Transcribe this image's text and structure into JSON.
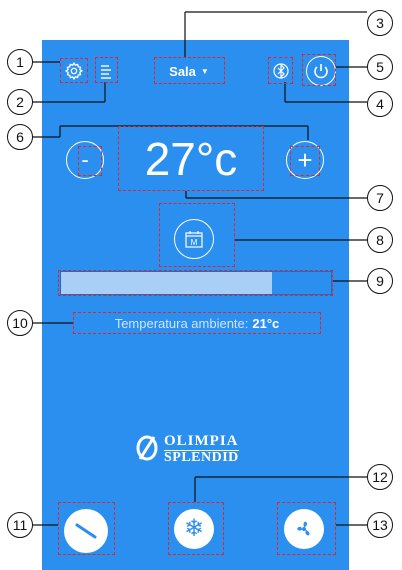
{
  "header": {
    "room_selector": "Sala",
    "settings_icon": "gear-icon",
    "menu_icon": "menu-icon",
    "bluetooth_icon": "bluetooth-icon",
    "power_icon": "power-icon"
  },
  "temperature": {
    "setpoint": "27°c",
    "minus_label": "-",
    "plus_label": "+"
  },
  "schedule": {
    "mode_letter": "M"
  },
  "progress": {
    "fraction": 0.78
  },
  "ambient": {
    "label": "Temperatura ambiente:",
    "value": "21°c"
  },
  "brand": {
    "line1": "OLIMPIA",
    "line2": "SPLENDID"
  },
  "modes": {
    "swing_icon": "swing-icon",
    "cool_icon": "snowflake-icon",
    "fan_icon": "fan-icon"
  },
  "callouts": [
    "1",
    "2",
    "3",
    "4",
    "5",
    "6",
    "7",
    "8",
    "9",
    "10",
    "11",
    "12",
    "13"
  ],
  "colors": {
    "background": "#2b8ff0",
    "bar_fill": "#a9cff6",
    "dash": "#e0262a"
  }
}
